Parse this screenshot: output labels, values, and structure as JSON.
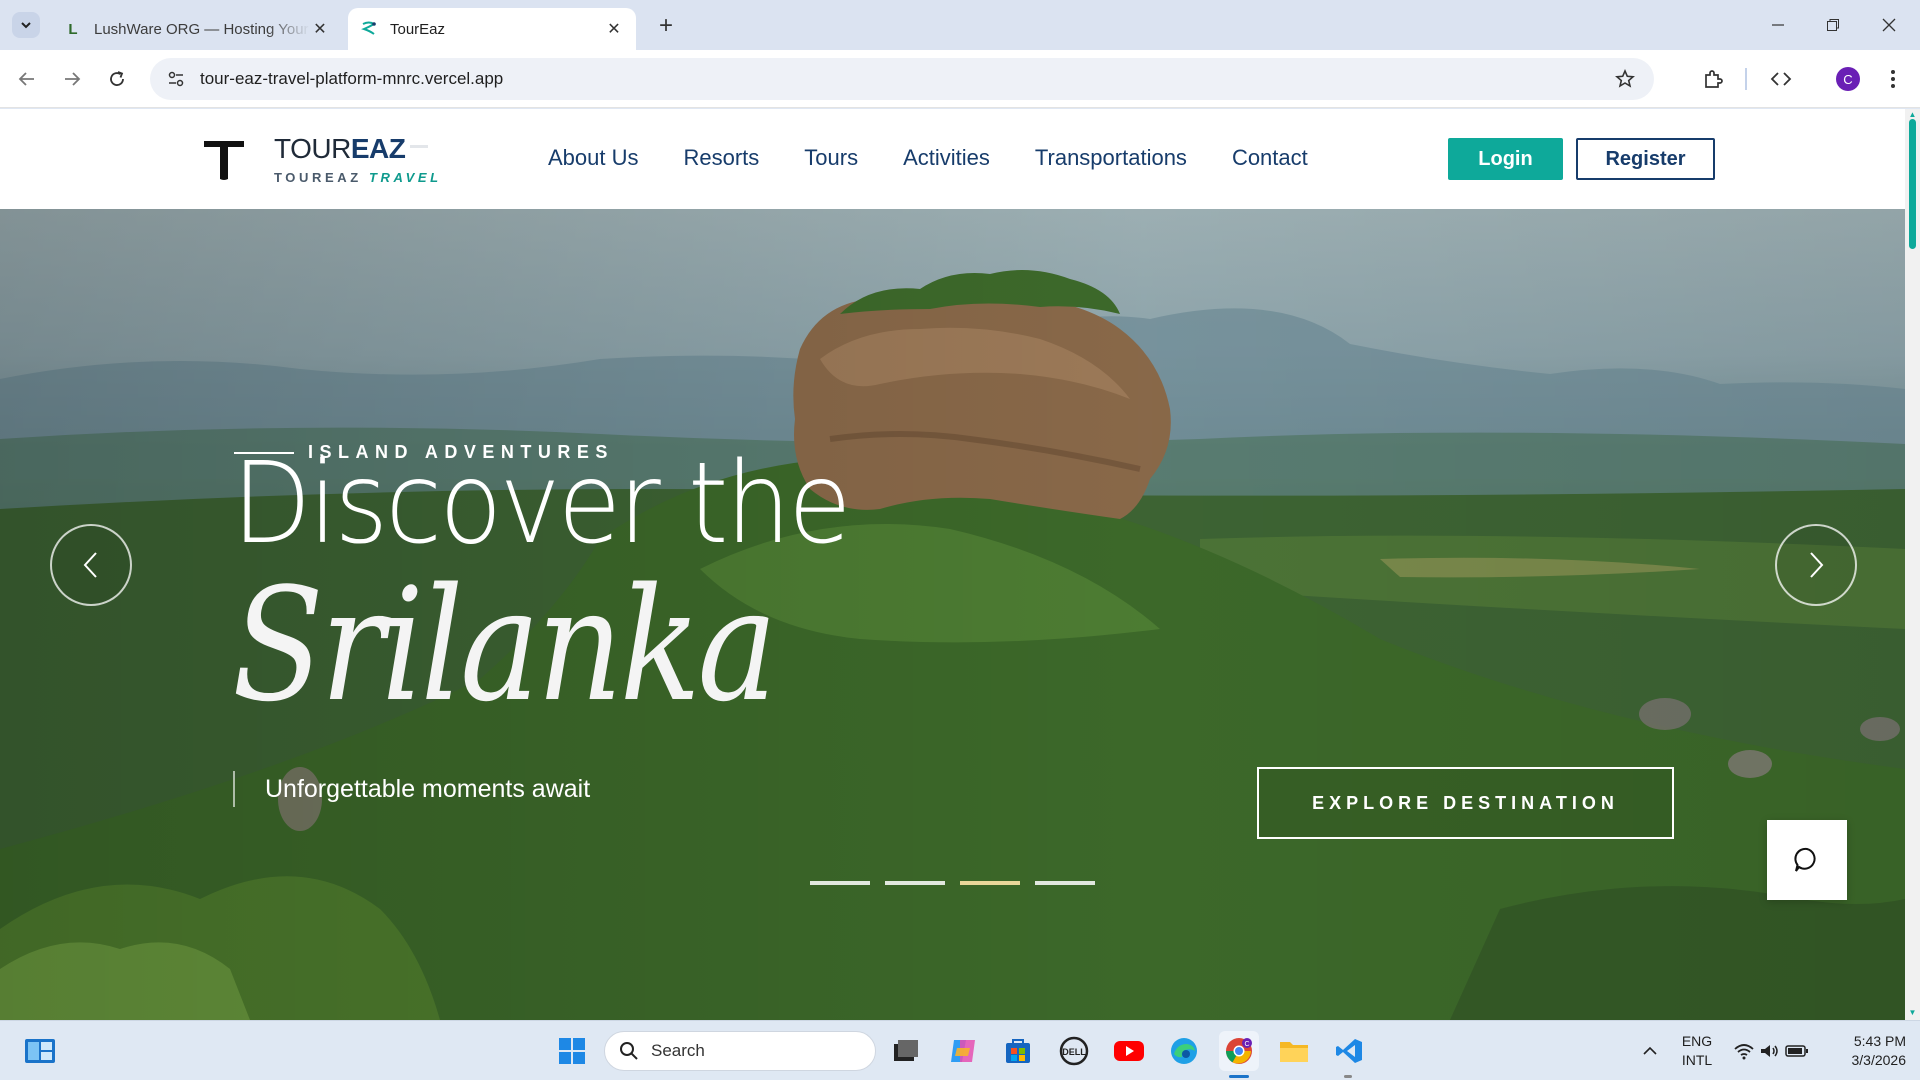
{
  "browser": {
    "tabs": [
      {
        "title": "LushWare ORG — Hosting Your",
        "favicon": "L",
        "active": false
      },
      {
        "title": "TourEaz",
        "favicon": "toureaz-logo",
        "active": true
      }
    ],
    "url": "tour-eaz-travel-platform-mnrc.vercel.app",
    "profile_initial": "C"
  },
  "site": {
    "logo": {
      "word_light": "TOUR",
      "word_bold": "EAZ",
      "sub_left": "TOUREAZ",
      "sub_right": "TRAVEL"
    },
    "nav": [
      "About Us",
      "Resorts",
      "Tours",
      "Activities",
      "Transportations",
      "Contact"
    ],
    "login_label": "Login",
    "register_label": "Register",
    "accent_color": "#0ea99a",
    "brand_color": "#173c6b"
  },
  "hero": {
    "eyebrow": "ISLAND ADVENTURES",
    "headline_line1": "Discover the",
    "headline_line2": "Srilanka",
    "tagline": "Unforgettable moments await",
    "cta_label": "EXPLORE DESTINATION",
    "slides_total": 4,
    "active_slide": 3
  },
  "taskbar": {
    "search_placeholder": "Search",
    "language_line1": "ENG",
    "language_line2": "INTL",
    "time": "5:43 PM",
    "date": "3/3/2026"
  }
}
